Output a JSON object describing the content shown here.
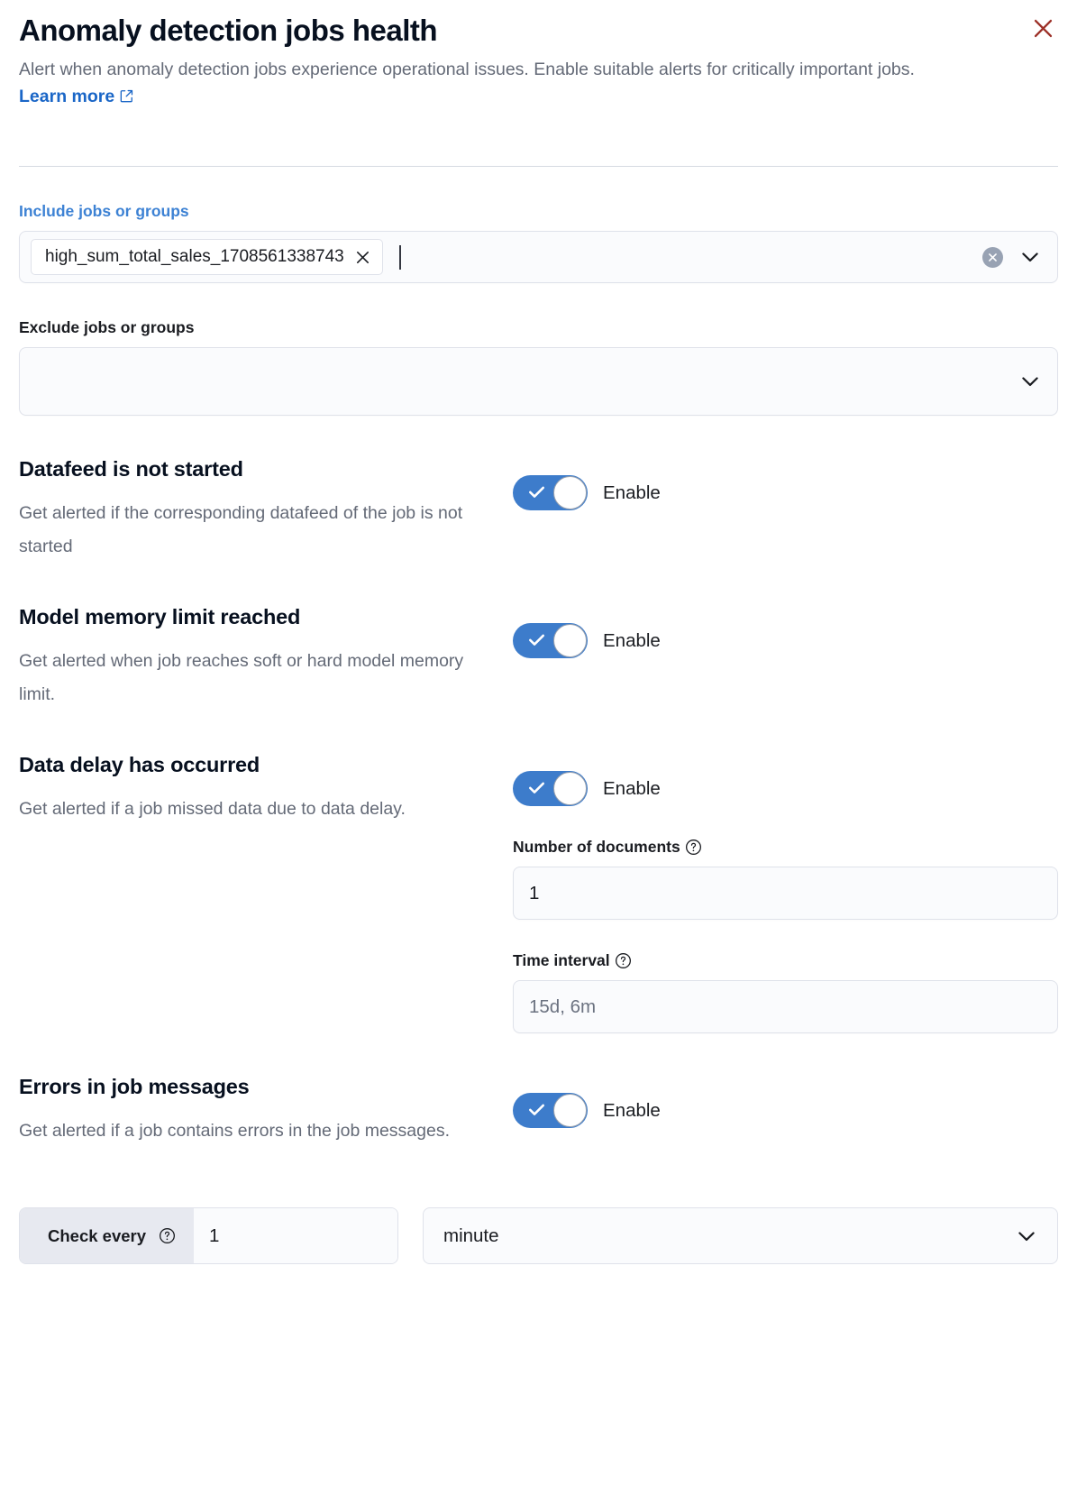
{
  "header": {
    "title": "Anomaly detection jobs health",
    "subtitle_part1": "Alert when anomaly detection jobs experience operational issues. Enable suitable alerts for critically important jobs.",
    "learn_more": "Learn more",
    "external_link_icon": "external-link-icon",
    "close_icon": "close-icon",
    "close_color": "#9c3028"
  },
  "include_field": {
    "label": "Include jobs or groups",
    "label_color": "#3d82d4",
    "selected": [
      {
        "text": "high_sum_total_sales_1708561338743",
        "remove_icon": "cross-icon"
      }
    ],
    "clear_icon": "clear-circle-icon",
    "dropdown_icon": "chevron-down-icon"
  },
  "exclude_field": {
    "label": "Exclude jobs or groups",
    "value": "",
    "dropdown_icon": "chevron-down-icon"
  },
  "alerts": [
    {
      "title": "Datafeed is not started",
      "description": "Get alerted if the corresponding datafeed of the job is not started",
      "toggle_label": "Enable",
      "enabled": true
    },
    {
      "title": "Model memory limit reached",
      "description": "Get alerted when job reaches soft or hard model memory limit.",
      "toggle_label": "Enable",
      "enabled": true
    },
    {
      "title": "Data delay has occurred",
      "description": "Get alerted if a job missed data due to data delay.",
      "toggle_label": "Enable",
      "enabled": true,
      "sub_fields": [
        {
          "label": "Number of documents",
          "help_icon": "question-circle-icon",
          "value": "1",
          "placeholder": ""
        },
        {
          "label": "Time interval",
          "help_icon": "question-circle-icon",
          "value": "",
          "placeholder": "15d, 6m"
        }
      ]
    },
    {
      "title": "Errors in job messages",
      "description": "Get alerted if a job contains errors in the job messages.",
      "toggle_label": "Enable",
      "enabled": true
    }
  ],
  "schedule": {
    "prepend_label": "Check every",
    "help_icon": "question-circle-icon",
    "interval_value": "1",
    "unit_value": "minute",
    "dropdown_icon": "chevron-down-icon"
  },
  "colors": {
    "accent_blue": "#3d7ccb",
    "link_blue": "#1a66c7",
    "close_red": "#9c3028",
    "field_bg": "#fafbfd",
    "border": "#dfe2ea"
  }
}
